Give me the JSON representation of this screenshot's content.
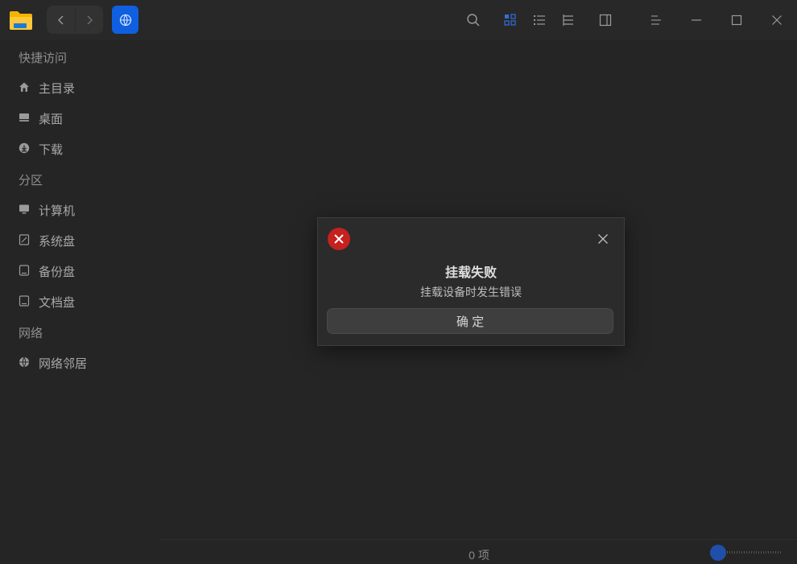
{
  "sidebar": {
    "groups": {
      "quick_access": "快捷访问",
      "partitions": "分区",
      "network": "网络"
    },
    "items": {
      "home": "主目录",
      "desktop": "桌面",
      "downloads": "下载",
      "computer": "计算机",
      "system_disk": "系统盘",
      "backup_disk": "备份盘",
      "documents_disk": "文档盘",
      "network_neighborhood": "网络邻居"
    }
  },
  "status": {
    "item_count": "0 项"
  },
  "dialog": {
    "title": "挂载失败",
    "message": "挂载设备时发生错误",
    "confirm_label": "确 定"
  },
  "icons": {
    "app": "file-manager-folder-icon",
    "accent_blue": "#0f5fe0",
    "error_red": "#c4211f"
  }
}
